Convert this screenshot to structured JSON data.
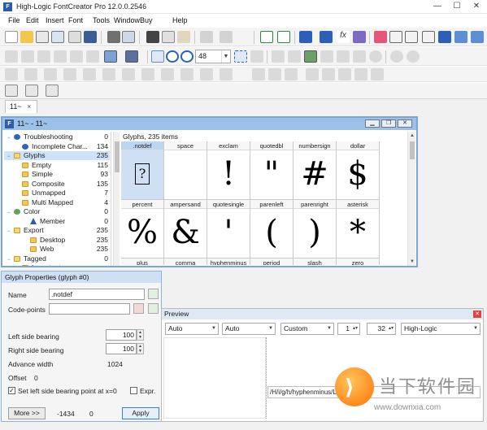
{
  "app": {
    "title": "High-Logic FontCreator Pro 12.0.0.2546",
    "window_controls": [
      "—",
      "☐",
      "✕"
    ]
  },
  "menu": [
    "File",
    "Edit",
    "Insert",
    "Font",
    "Tools",
    "Window",
    "Buy",
    "Help"
  ],
  "toolbar": {
    "zoom_value": "48"
  },
  "tabs": [
    {
      "label": "11~",
      "close": "×"
    }
  ],
  "font_window": {
    "title": "11~ - 11~",
    "tree": [
      {
        "label": "Troubleshooting",
        "count": "0",
        "icon": "info-icon",
        "indent": 0,
        "expander": "−"
      },
      {
        "label": "Incomplete Char...",
        "count": "134",
        "icon": "info-icon",
        "indent": 1
      },
      {
        "label": "Glyphs",
        "count": "235",
        "icon": "folder-icon",
        "indent": 0,
        "expander": "−",
        "selected": true
      },
      {
        "label": "Empty",
        "count": "115",
        "icon": "folder-icon",
        "indent": 1
      },
      {
        "label": "Simple",
        "count": "93",
        "icon": "folder-icon",
        "indent": 1
      },
      {
        "label": "Composite",
        "count": "135",
        "icon": "folder-icon",
        "indent": 1
      },
      {
        "label": "Unmapped",
        "count": "7",
        "icon": "folder-icon",
        "indent": 1
      },
      {
        "label": "Multi Mapped",
        "count": "4",
        "icon": "folder-icon",
        "indent": 1
      },
      {
        "label": "Color",
        "count": "0",
        "icon": "color-icon",
        "indent": 0,
        "expander": "−"
      },
      {
        "label": "Member",
        "count": "0",
        "icon": "warning-icon",
        "indent": 2
      },
      {
        "label": "Export",
        "count": "235",
        "icon": "folder-icon",
        "indent": 0,
        "expander": "−"
      },
      {
        "label": "Desktop",
        "count": "235",
        "icon": "folder-icon",
        "indent": 2
      },
      {
        "label": "Web",
        "count": "235",
        "icon": "folder-icon",
        "indent": 2
      },
      {
        "label": "Tagged",
        "count": "0",
        "icon": "folder-icon",
        "indent": 0,
        "expander": "−"
      },
      {
        "label": "Important",
        "count": "",
        "icon": "folder-icon",
        "indent": 1
      }
    ],
    "grid_header": "Glyphs, 235 items",
    "glyphs": [
      {
        "name": ".notdef",
        "char": "?",
        "notdef": true,
        "selected": true
      },
      {
        "name": "space",
        "char": ""
      },
      {
        "name": "exclam",
        "char": "!"
      },
      {
        "name": "quotedbl",
        "char": "\""
      },
      {
        "name": "numbersign",
        "char": "#"
      },
      {
        "name": "dollar",
        "char": "$"
      },
      {
        "name": "percent",
        "char": "%"
      },
      {
        "name": "ampersand",
        "char": "&"
      },
      {
        "name": "quotesingle",
        "char": "'"
      },
      {
        "name": "parenleft",
        "char": "("
      },
      {
        "name": "parenright",
        "char": ")"
      },
      {
        "name": "asterisk",
        "char": "*"
      },
      {
        "name": "plus",
        "char": ""
      },
      {
        "name": "comma",
        "char": ""
      },
      {
        "name": "hyphenminus",
        "char": ""
      },
      {
        "name": "period",
        "char": ""
      },
      {
        "name": "slash",
        "char": ""
      },
      {
        "name": "zero",
        "char": ""
      }
    ]
  },
  "glyph_properties": {
    "title": "Glyph Properties (glyph #0)",
    "name_label": "Name",
    "name_value": ".notdef",
    "codepoints_label": "Code-points",
    "codepoints_value": "",
    "lsb_label": "Left side bearing",
    "lsb_value": "100",
    "rsb_label": "Right side bearing",
    "rsb_value": "100",
    "advance_label": "Advance width",
    "advance_value": "1024",
    "offset_label": "Offset",
    "offset_value": "0",
    "set_lsb_label": "Set left side bearing point at x=0",
    "set_lsb_checked": true,
    "expr_label": "Expr.",
    "more_button": "More >>",
    "footer_value_1": "-1434",
    "footer_value_2": "0",
    "apply_button": "Apply"
  },
  "preview": {
    "title": "Preview",
    "combo1": "Auto",
    "combo2": "Auto",
    "combo3": "Custom",
    "size1": "1",
    "size2": "32",
    "renderer": "High-Logic",
    "rendered_glyph": "-",
    "text": "/H/i/g/h/hyphenminus/L/o/g/i/c"
  },
  "watermark": {
    "cn_text": "当下软件园",
    "url": "www.downxia.com"
  },
  "colors": {
    "window_border": "#79a6d6",
    "window_title": "#9cc1e8",
    "selection": "#cfe3f8",
    "accent": "#2c5ea8"
  }
}
